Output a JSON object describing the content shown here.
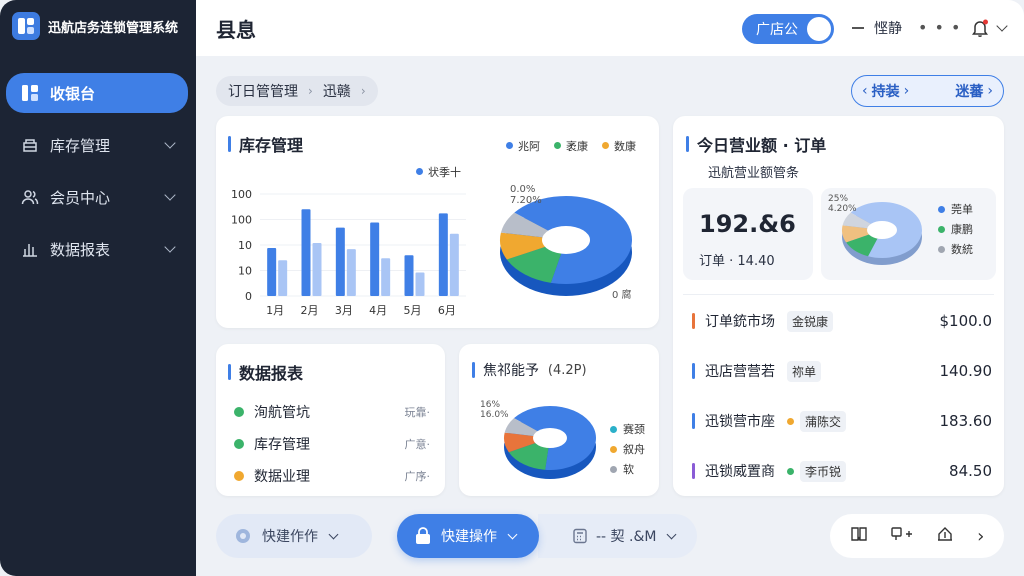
{
  "brand": {
    "name": "迅航店务连锁管理系统"
  },
  "sidebar": {
    "items": [
      {
        "label": "收银台",
        "icon": "dashboard-icon",
        "active": true
      },
      {
        "label": "库存管理",
        "icon": "inventory-icon",
        "active": false
      },
      {
        "label": "会员中心",
        "icon": "members-icon",
        "active": false
      },
      {
        "label": "数据报表",
        "icon": "report-icon",
        "active": false
      }
    ]
  },
  "header": {
    "title": "县息",
    "store_toggle": "广店公",
    "user_name": "悭静",
    "more": "• • •"
  },
  "breadcrumb": {
    "items": [
      "订日管管理",
      "迅赣"
    ]
  },
  "pager": {
    "prev": "持装",
    "next": "迷蕃"
  },
  "inventory": {
    "title": "库存管理",
    "legend": "状季十",
    "pie_legend": [
      "兆阿",
      "袤康",
      "数康"
    ],
    "pie_labels": {
      "top": "0.0%",
      "top2": "7.20%",
      "right": "0 腐"
    }
  },
  "revenue": {
    "title": "今日营业额 · 订单",
    "subtitle": "迅航营业额管条",
    "amount": "192.&6",
    "orders": "订单 · 14.40",
    "mini_legend": [
      "莞单",
      "康鹏",
      "数統"
    ],
    "mini_labels": {
      "a": "25%",
      "b": "4.20%"
    }
  },
  "ranking": [
    {
      "name": "订单銃市场",
      "tag": "金锐康",
      "value": "$100.0",
      "color": "#e8743b",
      "dot": ""
    },
    {
      "name": "迅店营营若",
      "tag": "祢单",
      "value": "140.90",
      "color": "#3f7fe6",
      "dot": ""
    },
    {
      "name": "迅锁营市座",
      "tag": "蒲陈交",
      "value": "183.60",
      "color": "#3f7fe6",
      "dot": "#f0a830"
    },
    {
      "name": "迅锁威置商",
      "tag": "李币锐",
      "value": "84.50",
      "color": "#8a5cd6",
      "dot": "#3bb36a"
    }
  ],
  "report": {
    "title": "数据报表",
    "rows": [
      {
        "label": "洵航管坑",
        "tag": "玩靠·",
        "color": "#3bb36a"
      },
      {
        "label": "库存管理",
        "tag": "广意·",
        "color": "#3bb36a"
      },
      {
        "label": "数据业理",
        "tag": "广序·",
        "color": "#f0a830"
      }
    ]
  },
  "sales": {
    "title": "焦祁能予",
    "title_suffix": "(4.2P)",
    "legend": [
      "赛颈",
      "叙舟",
      "软"
    ],
    "labels": {
      "a": "16%",
      "b": "16.0%"
    }
  },
  "bottom": {
    "quick1": "快建作作",
    "quick2": "快建操作",
    "quick3": "-- 契 .&M",
    "icons": [
      "book-icon",
      "add-icon",
      "upload-icon",
      "chevron-right-icon"
    ]
  },
  "chart_data": [
    {
      "type": "bar",
      "title": "库存管理",
      "categories": [
        "1月",
        "2月",
        "3月",
        "4月",
        "5月",
        "6月"
      ],
      "ytick_labels": [
        "0",
        "10",
        "10",
        "100",
        "100"
      ],
      "series": [
        {
          "name": "状季十",
          "values": [
            47,
            85,
            67,
            72,
            40,
            81
          ],
          "color": "#3f7fe6"
        },
        {
          "values": [
            35,
            52,
            46,
            37,
            23,
            61
          ],
          "color": "#a9c5f5"
        }
      ]
    },
    {
      "type": "pie",
      "labels": [
        "兆阿",
        "袤康",
        "数康",
        "other"
      ],
      "values": [
        68,
        14,
        10,
        8
      ],
      "colors": [
        "#3f7fe6",
        "#3bb36a",
        "#f0a830",
        "#b8bec9"
      ]
    },
    {
      "type": "pie",
      "labels": [
        "莞单",
        "康鹏",
        "数統",
        "other"
      ],
      "values": [
        70,
        12,
        10,
        8
      ],
      "colors": [
        "#a9c5f5",
        "#3bb36a",
        "#f0c080",
        "#d0d5de"
      ]
    },
    {
      "type": "pie",
      "labels": [
        "赛颈",
        "叙舟",
        "软",
        "other"
      ],
      "values": [
        66,
        16,
        10,
        8
      ],
      "colors": [
        "#3f7fe6",
        "#3bb36a",
        "#e8743b",
        "#b8bec9"
      ]
    }
  ]
}
